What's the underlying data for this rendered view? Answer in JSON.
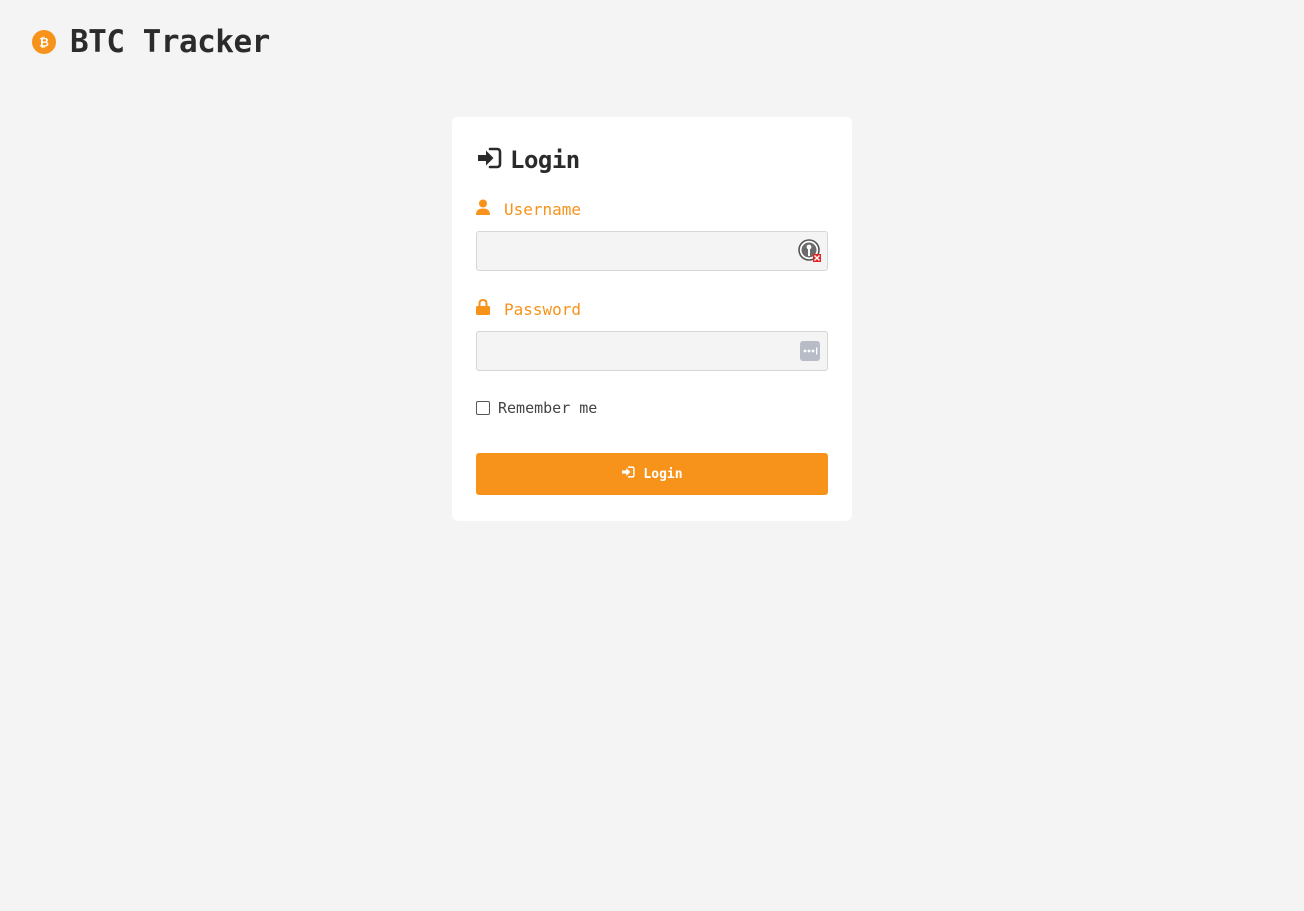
{
  "header": {
    "title": "BTC Tracker",
    "logo_icon": "bitcoin-icon"
  },
  "login_form": {
    "title": "Login",
    "title_icon": "sign-in-icon",
    "username": {
      "label": "Username",
      "icon": "user-icon",
      "value": "",
      "badge_icon": "password-manager-icon"
    },
    "password": {
      "label": "Password",
      "icon": "lock-icon",
      "value": "",
      "badge_icon": "password-dots-icon"
    },
    "remember_me": {
      "label": "Remember me",
      "checked": false
    },
    "submit": {
      "label": "Login",
      "icon": "sign-in-icon"
    }
  },
  "colors": {
    "accent": "#f7931a",
    "background": "#f4f4f4",
    "card": "#ffffff",
    "text": "#2b2b2b"
  }
}
